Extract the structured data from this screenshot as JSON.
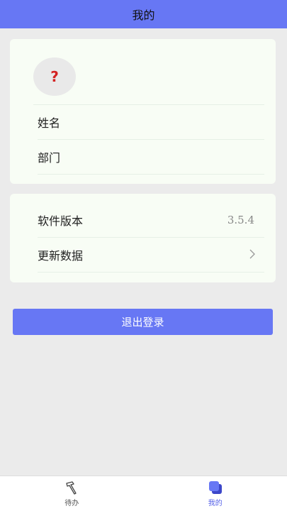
{
  "header": {
    "title": "我的"
  },
  "profile": {
    "avatar_placeholder": "?",
    "name_label": "姓名",
    "department_label": "部门"
  },
  "settings": {
    "version_label": "软件版本",
    "version_value": "3.5.4",
    "update_label": "更新数据",
    "update_chevron": ">"
  },
  "logout_label": "退出登录",
  "tabbar": {
    "todo_label": "待办",
    "mine_label": "我的",
    "todo_icon": "hammer-icon",
    "mine_icon": "layers-icon",
    "active_color": "#5561e8"
  },
  "colors": {
    "accent": "#6777f4",
    "card_bg": "#f8fdf5",
    "page_bg": "#ebebeb"
  }
}
